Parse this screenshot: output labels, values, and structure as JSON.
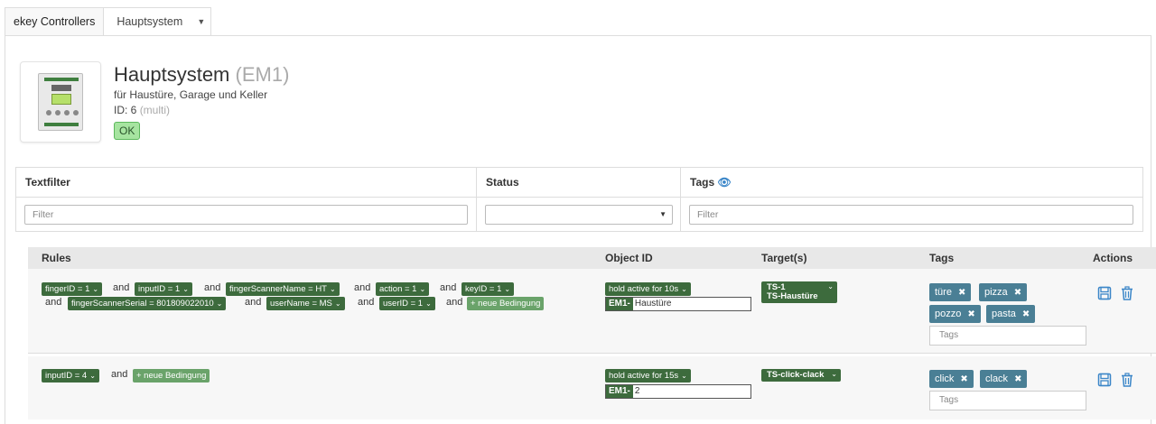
{
  "nav": {
    "brand": "ekey Controllers",
    "system": "Hauptsystem"
  },
  "header": {
    "name": "Hauptsystem",
    "code": "(EM1)",
    "description": "für Haustüre, Garage und Keller",
    "id_label": "ID: 6",
    "id_type": "(multi)",
    "status": "OK"
  },
  "filters": {
    "text": {
      "label": "Textfilter",
      "placeholder": "Filter"
    },
    "status": {
      "label": "Status",
      "value": ""
    },
    "tags": {
      "label": "Tags",
      "placeholder": "Filter"
    }
  },
  "rules_table": {
    "columns": [
      "Rules",
      "Object ID",
      "Target(s)",
      "Tags",
      "Actions"
    ],
    "rows": [
      {
        "conditions": [
          "fingerID = 1",
          "inputID = 1",
          "fingerScannerName = HT",
          "action = 1",
          "keyID = 1",
          "fingerScannerSerial = 801809022010",
          "userName = MS",
          "userID = 1"
        ],
        "joiner": "and",
        "add_label": "+ neue Bedingung",
        "object_mode": "hold active for 10s",
        "object_prefix": "EM1-",
        "object_value": "Haustüre",
        "targets": [
          "TS-1",
          "TS-Haustüre"
        ],
        "tags": [
          "türe",
          "pizza",
          "pozzo",
          "pasta"
        ],
        "tags_placeholder": "Tags"
      },
      {
        "conditions": [
          "inputID = 4"
        ],
        "joiner": "and",
        "add_label": "+ neue Bedingung",
        "object_mode": "hold active for 15s",
        "object_prefix": "EM1-",
        "object_value": "2",
        "targets": [
          "TS-click-clack"
        ],
        "tags": [
          "click",
          "clack"
        ],
        "tags_placeholder": "Tags"
      }
    ]
  },
  "colors": {
    "condition_chip": "#3d6b3d",
    "tag_chip": "#4a7f95",
    "action_icon": "#3b86c8",
    "ok_badge": "#a6e4a0"
  }
}
